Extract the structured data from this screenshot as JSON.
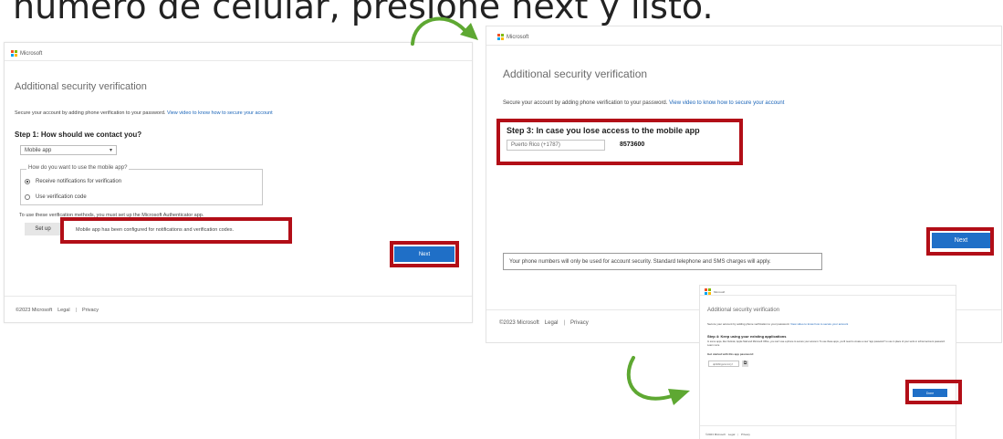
{
  "heading": {
    "text": "número de celular, presione next y listo."
  },
  "brand": {
    "name": "Microsoft",
    "colors": [
      "#f25022",
      "#7fba00",
      "#00a4ef",
      "#ffb900"
    ]
  },
  "panel_a": {
    "title": "Additional security verification",
    "intro": "Secure your account by adding phone verification to your password.",
    "intro_link": "View video to know how to secure your account",
    "step_title": "Step 1: How should we contact you?",
    "contact_method": "Mobile app",
    "fieldset_legend": "How do you want to use the mobile app?",
    "options": [
      {
        "label": "Receive notifications for verification",
        "selected": true
      },
      {
        "label": "Use verification code",
        "selected": false
      }
    ],
    "hint": "To use these verification methods, you must set up the Microsoft Authenticator app.",
    "setup_label": "Set up",
    "configured_msg": "Mobile app has been configured for notifications and verification codes.",
    "next_label": "Next",
    "footer": {
      "copyright": "©2023 Microsoft",
      "legal": "Legal",
      "privacy": "Privacy"
    }
  },
  "panel_b": {
    "title": "Additional security verification",
    "intro": "Secure your account by adding phone verification to your password.",
    "intro_link": "View video to know how to secure your account",
    "step_title": "Step 3: In case you lose access to the mobile app",
    "country": "Puerto Rico (+1787)",
    "phone": "8573600",
    "notice": "Your phone numbers will only be used for account security. Standard telephone and SMS charges will apply.",
    "next_label": "Next",
    "footer": {
      "copyright": "©2023 Microsoft",
      "legal": "Legal",
      "privacy": "Privacy"
    }
  },
  "panel_c": {
    "title": "Additional security verification",
    "intro": "Secure your account by adding phone verification to your password.",
    "intro_link": "View video to know how to secure your account",
    "step_title": "Step 4: Keep using your existing applications",
    "body": "In some apps, like Outlook, Apple Mail and Microsoft Office, you can't use a phone to secure your account. To use these apps, you'll need to create a new \"app password\" to use in place of your work or school account password. Learn more",
    "get_started": "Get started with this app password:",
    "app_password": "qkhtlbhgsrxcmzyf",
    "done_label": "Done",
    "footer": {
      "copyright": "©2023 Microsoft",
      "legal": "Legal",
      "privacy": "Privacy"
    }
  },
  "colors": {
    "accent": "#1f6fc7",
    "highlight": "#b20e17",
    "arrow": "#5ea832"
  }
}
